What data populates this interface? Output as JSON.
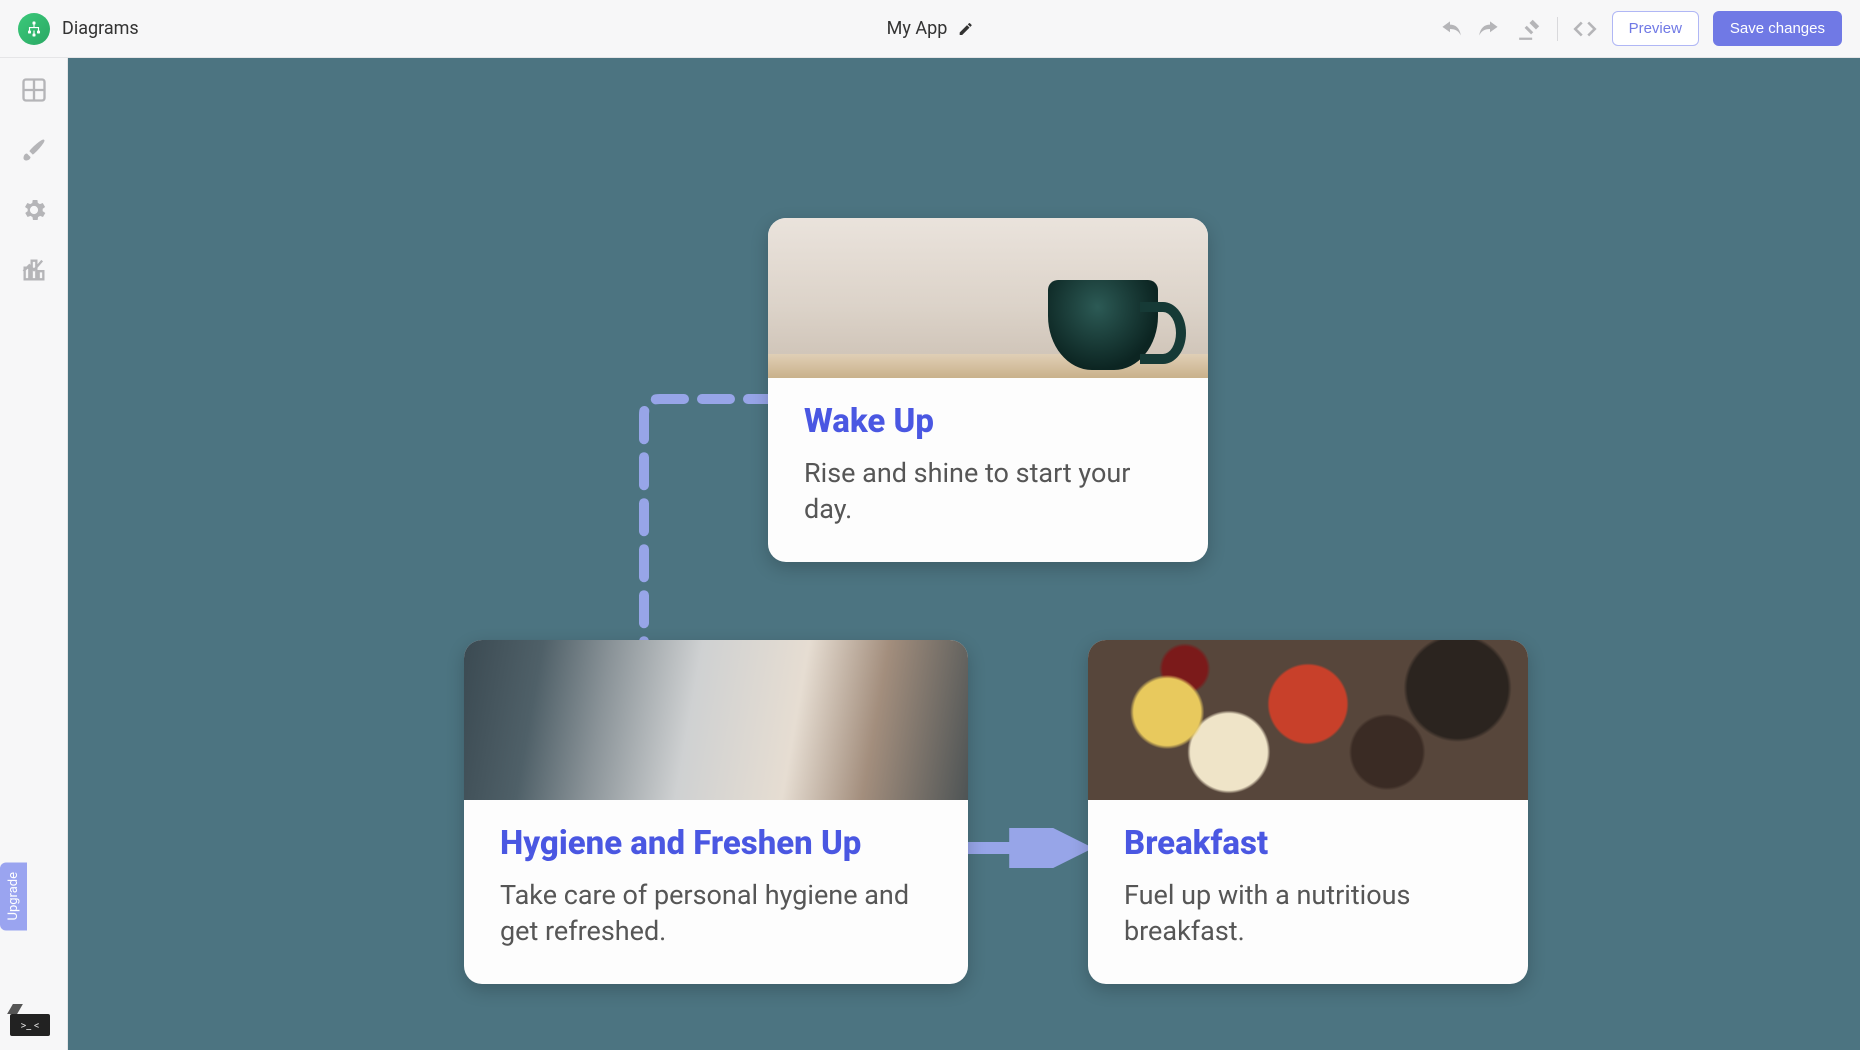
{
  "topbar": {
    "page_label": "Diagrams",
    "app_title": "My App",
    "preview_label": "Preview",
    "save_label": "Save changes"
  },
  "sidebar": {
    "upgrade_label": "Upgrade"
  },
  "cards": {
    "wakeup": {
      "title": "Wake Up",
      "desc": "Rise and shine to start your day."
    },
    "hygiene": {
      "title": "Hygiene and Freshen Up",
      "desc": "Take care of personal hygiene and get refreshed."
    },
    "breakfast": {
      "title": "Breakfast",
      "desc": "Fuel up with a nutritious breakfast."
    }
  },
  "colors": {
    "accent": "#4a57e2",
    "canvas_bg": "#4c7481",
    "connector": "#97a5e8"
  }
}
